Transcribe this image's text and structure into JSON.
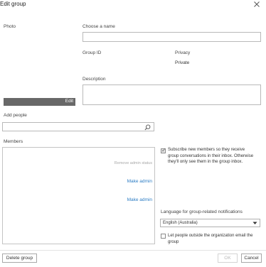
{
  "dialog": {
    "title": "Edit group"
  },
  "photo": {
    "label": "Photo",
    "edit_label": "Edit"
  },
  "name": {
    "label": "Choose a name",
    "value": "",
    "placeholder": ""
  },
  "group_id": {
    "label": "Group ID"
  },
  "privacy": {
    "label": "Privacy",
    "value": "Private"
  },
  "description": {
    "label": "Description",
    "value": ""
  },
  "add_people": {
    "label": "Add people",
    "value": "",
    "placeholder": ""
  },
  "members": {
    "label": "Members",
    "remove_admin_label": "Remove admin status",
    "make_admin_labels": [
      "Make admin",
      "Make admin"
    ]
  },
  "subscribe": {
    "checked": true,
    "lines": [
      "Subscribe new members so they receive",
      "group conversations in their inbox. Otherwise",
      "they'll only see them in the group inbox."
    ]
  },
  "language": {
    "label": "Language for group-related notifications",
    "selected": "English (Australia)"
  },
  "outside_email": {
    "checked": false,
    "lines": [
      "Let people outside the organization email the",
      "group"
    ]
  },
  "footer": {
    "delete_label": "Delete group",
    "ok_label": "OK",
    "cancel_label": "Cancel"
  },
  "icons": [
    "close-icon",
    "search-icon",
    "chevron-down-icon",
    "checkmark-icon"
  ]
}
